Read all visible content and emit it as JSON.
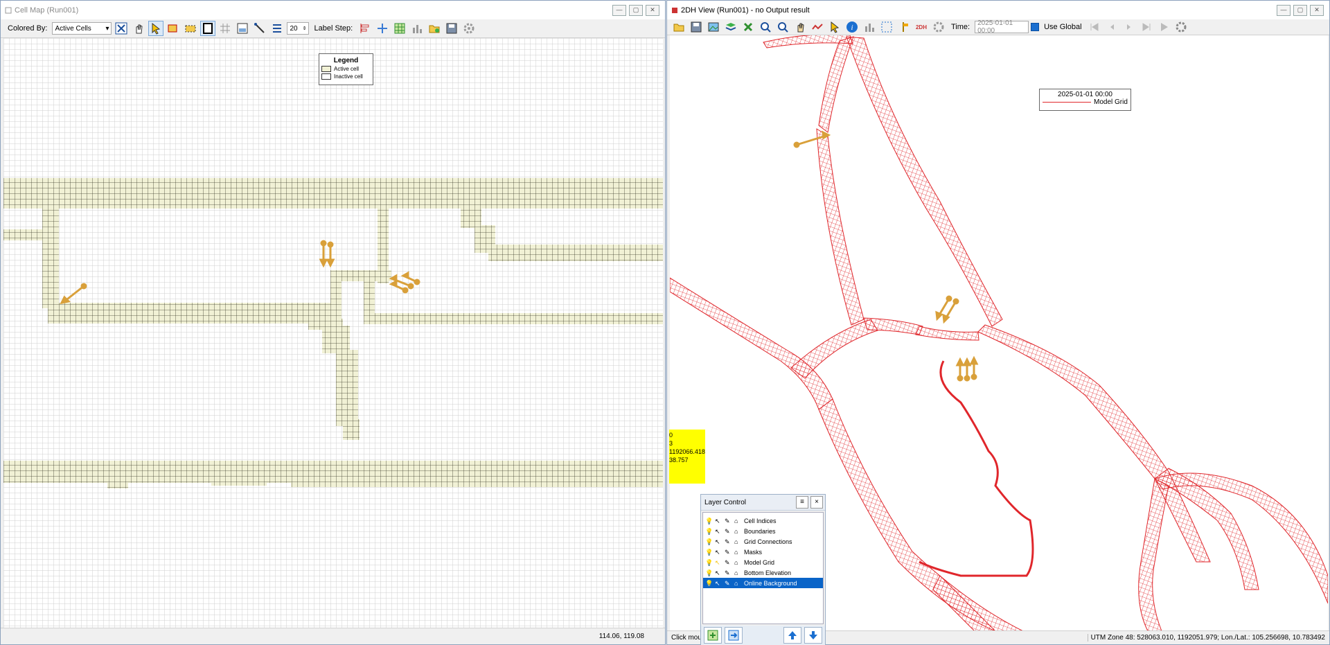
{
  "left": {
    "title": "Cell Map (Run001)",
    "colored_by_label": "Colored By:",
    "colored_by_value": "Active Cells",
    "step_value": "20",
    "label_step": "Label Step:",
    "legend": {
      "title": "Legend",
      "items": [
        "Active cell",
        "Inactive cell"
      ]
    },
    "status_coords": "114.06, 119.08"
  },
  "right": {
    "title": "2DH View (Run001) - no Output result",
    "time_label": "Time:",
    "time_value": "2025-01-01 00:00",
    "use_global": "Use Global",
    "map_legend": {
      "time": "2025-01-01 00:00",
      "item": "Model Grid"
    },
    "info_lines": [
      "0",
      "3",
      "1192066.418",
      "38.757"
    ],
    "status_left": "Click mouse to get grid cell information",
    "status_right": "UTM Zone 48: 528063.010, 1192051.979; Lon./Lat.: 105.256698, 10.783492"
  },
  "layer_control": {
    "title": "Layer Control",
    "menu_icon": "≡",
    "close_icon": "×",
    "layers": [
      "Cell Indices",
      "Boundaries",
      "Grid Connections",
      "Masks",
      "Model Grid",
      "Bottom Elevation",
      "Online Background"
    ],
    "selected": "Online Background"
  },
  "colors": {
    "active_cell": "#f1f1d5",
    "grid_red": "#e0262b",
    "arrow": "#d9a03a",
    "selection": "#0a64c8"
  }
}
